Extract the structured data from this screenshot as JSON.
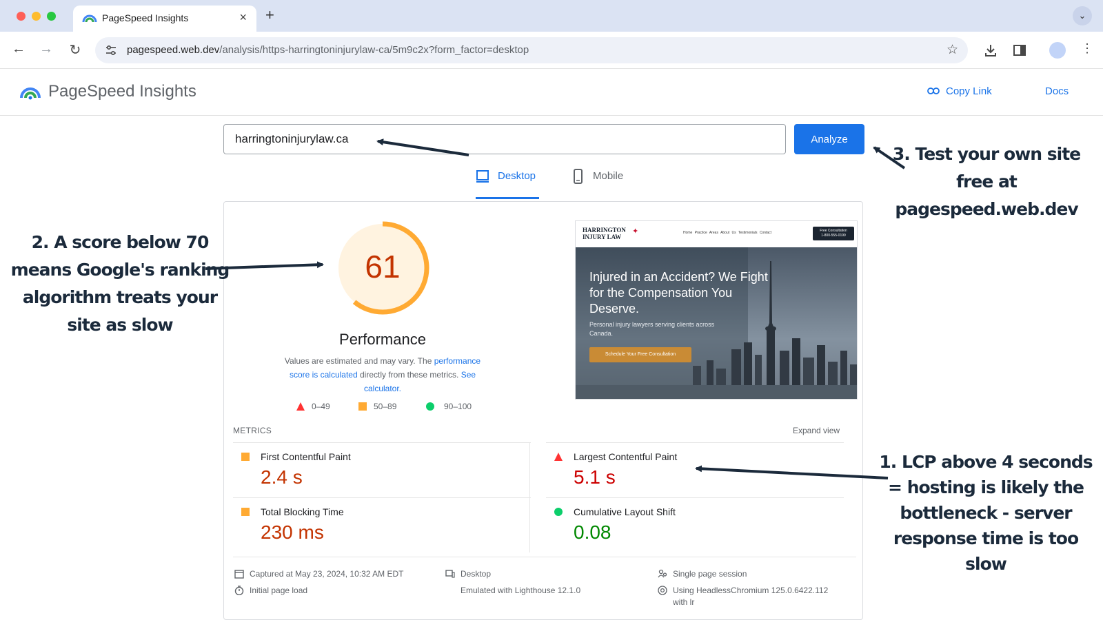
{
  "browser": {
    "tab_title": "PageSpeed Insights",
    "tab_close": "×",
    "new_tab": "+",
    "tab_menu": "⌄",
    "url_host": "pagespeed.web.dev",
    "url_path": "/analysis/https-harringtoninjurylaw-ca/5m9c2x?form_factor=desktop",
    "back": "←",
    "forward": "→",
    "reload": "↻",
    "star": "☆",
    "kebab": "⋮"
  },
  "header": {
    "title": "PageSpeed Insights",
    "copy_link": "Copy Link",
    "docs": "Docs"
  },
  "search": {
    "value": "harringtoninjurylaw.ca",
    "analyze": "Analyze"
  },
  "device_tabs": {
    "desktop": "Desktop",
    "mobile": "Mobile"
  },
  "performance": {
    "score": 61,
    "score_text": "61",
    "title": "Performance",
    "desc_1": "Values are estimated and may vary. The ",
    "desc_link_1": "performance score is calculated",
    "desc_2": " directly from these metrics. ",
    "desc_link_2": "See calculator.",
    "legend": [
      {
        "label": "0–49",
        "color": "#ff3333"
      },
      {
        "label": "50–89",
        "color": "#ffaa33"
      },
      {
        "label": "90–100",
        "color": "#0cce6b"
      }
    ]
  },
  "screenshot": {
    "brand_line1": "HARRINGTON",
    "brand_line2": "INJURY LAW",
    "nav_links": "Home  Practice Areas  About Us  Testimonials  Contact",
    "cta_line1": "Free Consultation",
    "cta_line2": "1-800-555-0199",
    "headline": "Injured in an Accident? We Fight for the Compensation You Deserve.",
    "sub": "Personal injury lawyers serving clients across Canada.",
    "button": "Schedule Your Free Consultation"
  },
  "metrics": {
    "label": "METRICS",
    "expand": "Expand view",
    "fcp": {
      "name": "First Contentful Paint",
      "value": "2.4 s",
      "status": "average"
    },
    "lcp": {
      "name": "Largest Contentful Paint",
      "value": "5.1 s",
      "status": "poor"
    },
    "tbt": {
      "name": "Total Blocking Time",
      "value": "230 ms",
      "status": "average"
    },
    "cls": {
      "name": "Cumulative Layout Shift",
      "value": "0.08",
      "status": "good"
    }
  },
  "footer": {
    "captured": "Captured at May 23, 2024, 10:32 AM EDT",
    "initial_load": "Initial page load",
    "device": "Desktop",
    "emulated": "Emulated with Lighthouse 12.1.0",
    "session": "Single page session",
    "browser_line1": "Using HeadlessChromium 125.0.6422.112",
    "browser_line2": "with lr"
  },
  "annotations": {
    "a1": "1. LCP above 4 seconds = hosting is likely the bottleneck - server response time is too slow",
    "a2": "2. A score below 70 means Google's ranking algorithm treats your site as slow",
    "a3": "3. Test your own site free at pagespeed.web.dev"
  },
  "colors": {
    "accent": "#1a73e8",
    "average": "#ffaa33",
    "poor": "#ff3333",
    "good": "#0cce6b",
    "annotation": "#1b2a3b"
  }
}
